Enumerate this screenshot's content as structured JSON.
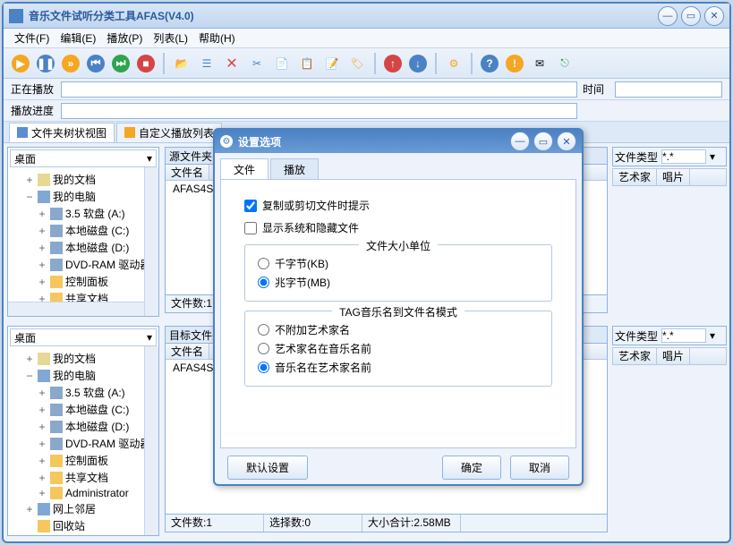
{
  "window": {
    "title": "音乐文件试听分类工具AFAS(V4.0)"
  },
  "menu": {
    "file": "文件(F)",
    "edit": "编辑(E)",
    "play": "播放(P)",
    "list": "列表(L)",
    "help": "帮助(H)"
  },
  "play": {
    "now_label": "正在播放",
    "progress_label": "播放进度",
    "time_label": "时间"
  },
  "tabs": {
    "tree_view": "文件夹树状视图",
    "custom_list": "自定义播放列表"
  },
  "tree": {
    "desktop": "桌面",
    "my_docs": "我的文档",
    "my_pc": "我的电脑",
    "floppy": "3.5 软盘 (A:)",
    "disk_c": "本地磁盘 (C:)",
    "disk_d": "本地磁盘 (D:)",
    "dvd": "DVD-RAM 驱动器",
    "ctrl_panel": "控制面板",
    "shared": "共享文档",
    "admin": "Administrator",
    "network": "网上邻居",
    "recycle": "回收站"
  },
  "panels": {
    "src_label": "源文件夹",
    "dst_label": "目标文件夹",
    "col_filename": "文件名",
    "file_item": "AFAS4Setup",
    "filetype_label": "文件类型",
    "filetype_val": "*.*",
    "col_artist": "艺术家",
    "col_album": "唱片"
  },
  "status": {
    "files": "文件数:1",
    "selected": "选择数:0",
    "size": "大小合计:2.58MB"
  },
  "dialog": {
    "title": "设置选项",
    "tab_file": "文件",
    "tab_play": "播放",
    "chk_prompt": "复制或剪切文件时提示",
    "chk_hidden": "显示系统和隐藏文件",
    "group_unit": "文件大小单位",
    "unit_kb": "千字节(KB)",
    "unit_mb": "兆字节(MB)",
    "group_tag": "TAG音乐名到文件名模式",
    "tag_none": "不附加艺术家名",
    "tag_artist_first": "艺术家名在音乐名前",
    "tag_music_first": "音乐名在艺术家名前",
    "btn_default": "默认设置",
    "btn_ok": "确定",
    "btn_cancel": "取消"
  }
}
